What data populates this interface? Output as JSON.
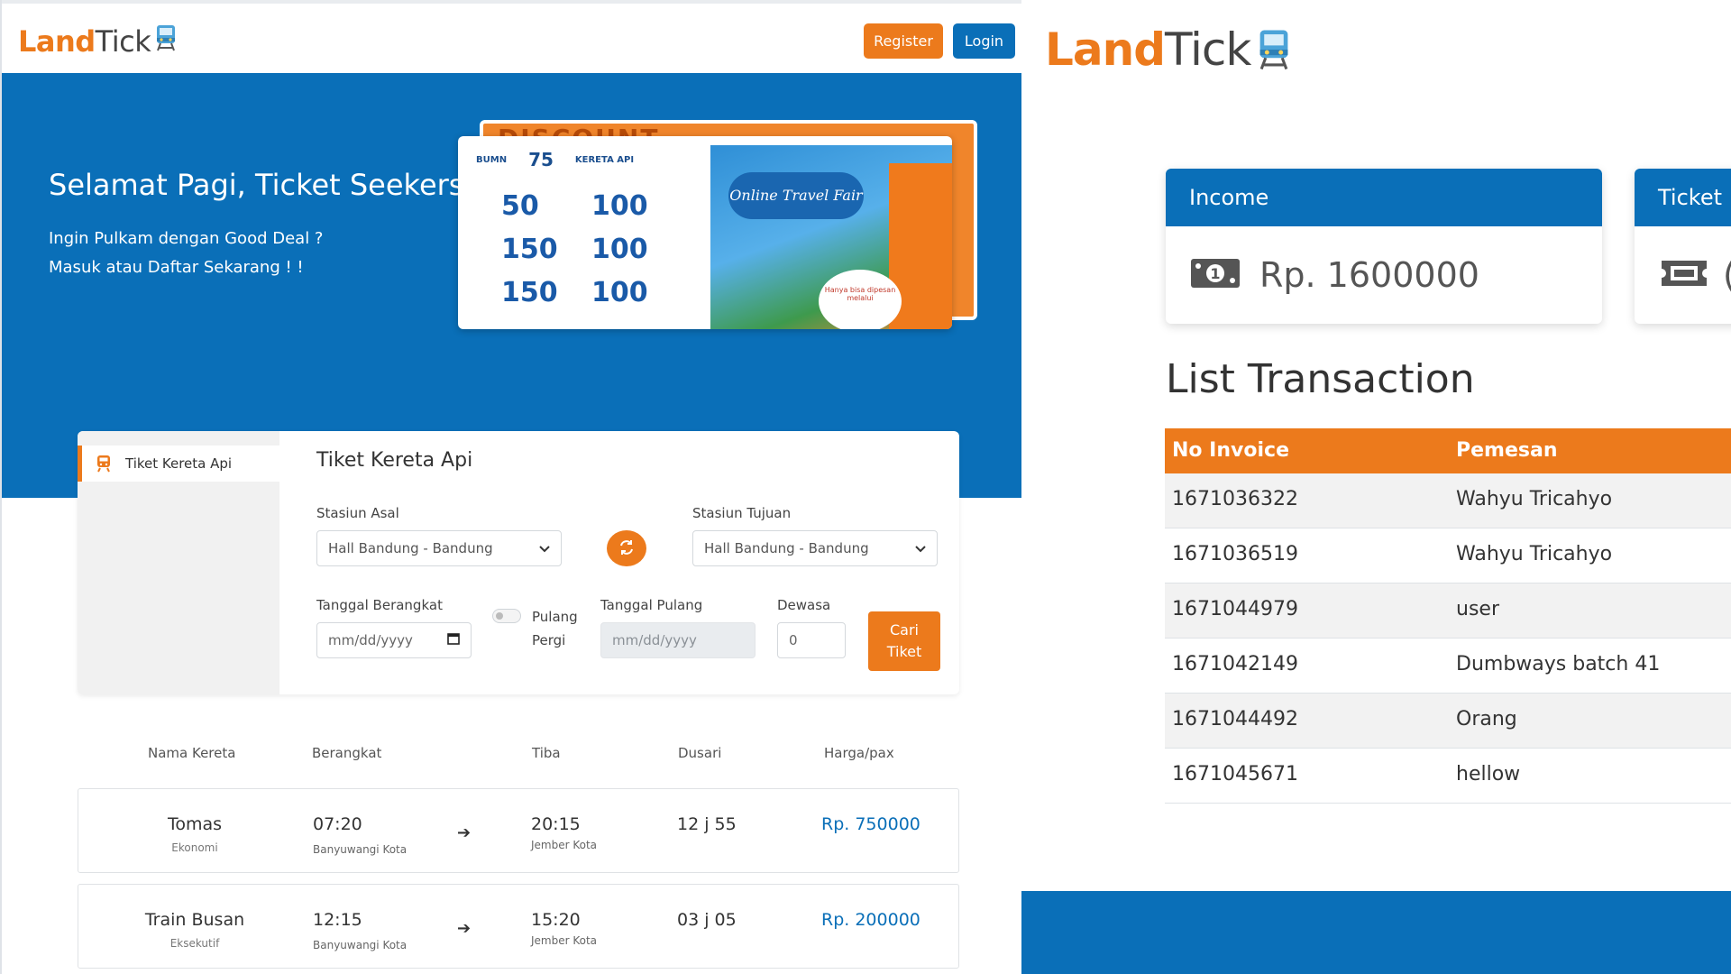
{
  "left_page": {
    "brand": {
      "land": "Land",
      "tick": "Tick"
    },
    "nav": {
      "register": "Register",
      "login": "Login"
    },
    "hero": {
      "title": "Selamat Pagi, Ticket Seekers !",
      "sub1": "Ingin Pulkam dengan Good Deal ?",
      "sub2": "Masuk atau Daftar Sekarang ! !"
    },
    "promo": {
      "banner_top": "DISCOUNT",
      "logo_bumn": "BUMN",
      "logo_75": "75",
      "logo_kai": "KERETA API",
      "prices": [
        "50",
        "100",
        "150",
        "100",
        "150",
        "100"
      ],
      "fair": "Online Travel Fair",
      "cta": "Hanya bisa dipesan melalui"
    },
    "search": {
      "side_item": "Tiket Kereta Api",
      "title": "Tiket Kereta Api",
      "asal_label": "Stasiun Asal",
      "asal_value": "Hall Bandung - Bandung",
      "tujuan_label": "Stasiun Tujuan",
      "tujuan_value": "Hall Bandung - Bandung",
      "berangkat_label": "Tanggal Berangkat",
      "berangkat_placeholder": "mm/dd/yyyy",
      "pulang_pergi_label1": "Pulang",
      "pulang_pergi_label2": "Pergi",
      "pulang_label": "Tanggal Pulang",
      "pulang_placeholder": "mm/dd/yyyy",
      "dewasa_label": "Dewasa",
      "dewasa_value": "0",
      "cari_line1": "Cari",
      "cari_line2": "Tiket"
    },
    "table": {
      "headers": [
        "Nama Kereta",
        "Berangkat",
        "Tiba",
        "Dusari",
        "Harga/pax"
      ],
      "rows": [
        {
          "name": "Tomas",
          "class": "Ekonomi",
          "depart": "07:20",
          "depart_station": "Banyuwangi Kota",
          "arrive": "20:15",
          "arrive_station": "Jember Kota",
          "duration": "12 j 55",
          "price": "Rp. 750000"
        },
        {
          "name": "Train Busan",
          "class": "Eksekutif",
          "depart": "12:15",
          "depart_station": "Banyuwangi Kota",
          "arrive": "15:20",
          "arrive_station": "Jember Kota",
          "duration": "03 j 05",
          "price": "Rp. 200000"
        }
      ]
    }
  },
  "right_page": {
    "brand": {
      "land": "Land",
      "tick": "Tick"
    },
    "income": {
      "label": "Income",
      "value": "Rp. 1600000"
    },
    "ticket": {
      "label": "Ticket"
    },
    "list_title": "List Transaction",
    "table": {
      "headers": [
        "No Invoice",
        "Pemesan"
      ],
      "rows": [
        {
          "invoice": "1671036322",
          "name": "Wahyu Tricahyo"
        },
        {
          "invoice": "1671036519",
          "name": "Wahyu Tricahyo"
        },
        {
          "invoice": "1671044979",
          "name": "user"
        },
        {
          "invoice": "1671042149",
          "name": "Dumbways batch 41"
        },
        {
          "invoice": "1671044492",
          "name": "Orang"
        },
        {
          "invoice": "1671045671",
          "name": "hellow"
        }
      ]
    }
  },
  "colors": {
    "primary": "#0a6fb8",
    "accent": "#ec7a1c",
    "text": "#333333"
  },
  "icons": [
    "train-icon",
    "money-icon",
    "ticket-icon",
    "swap-icon",
    "calendar-icon",
    "chevron-down-icon",
    "arrow-right-icon"
  ]
}
